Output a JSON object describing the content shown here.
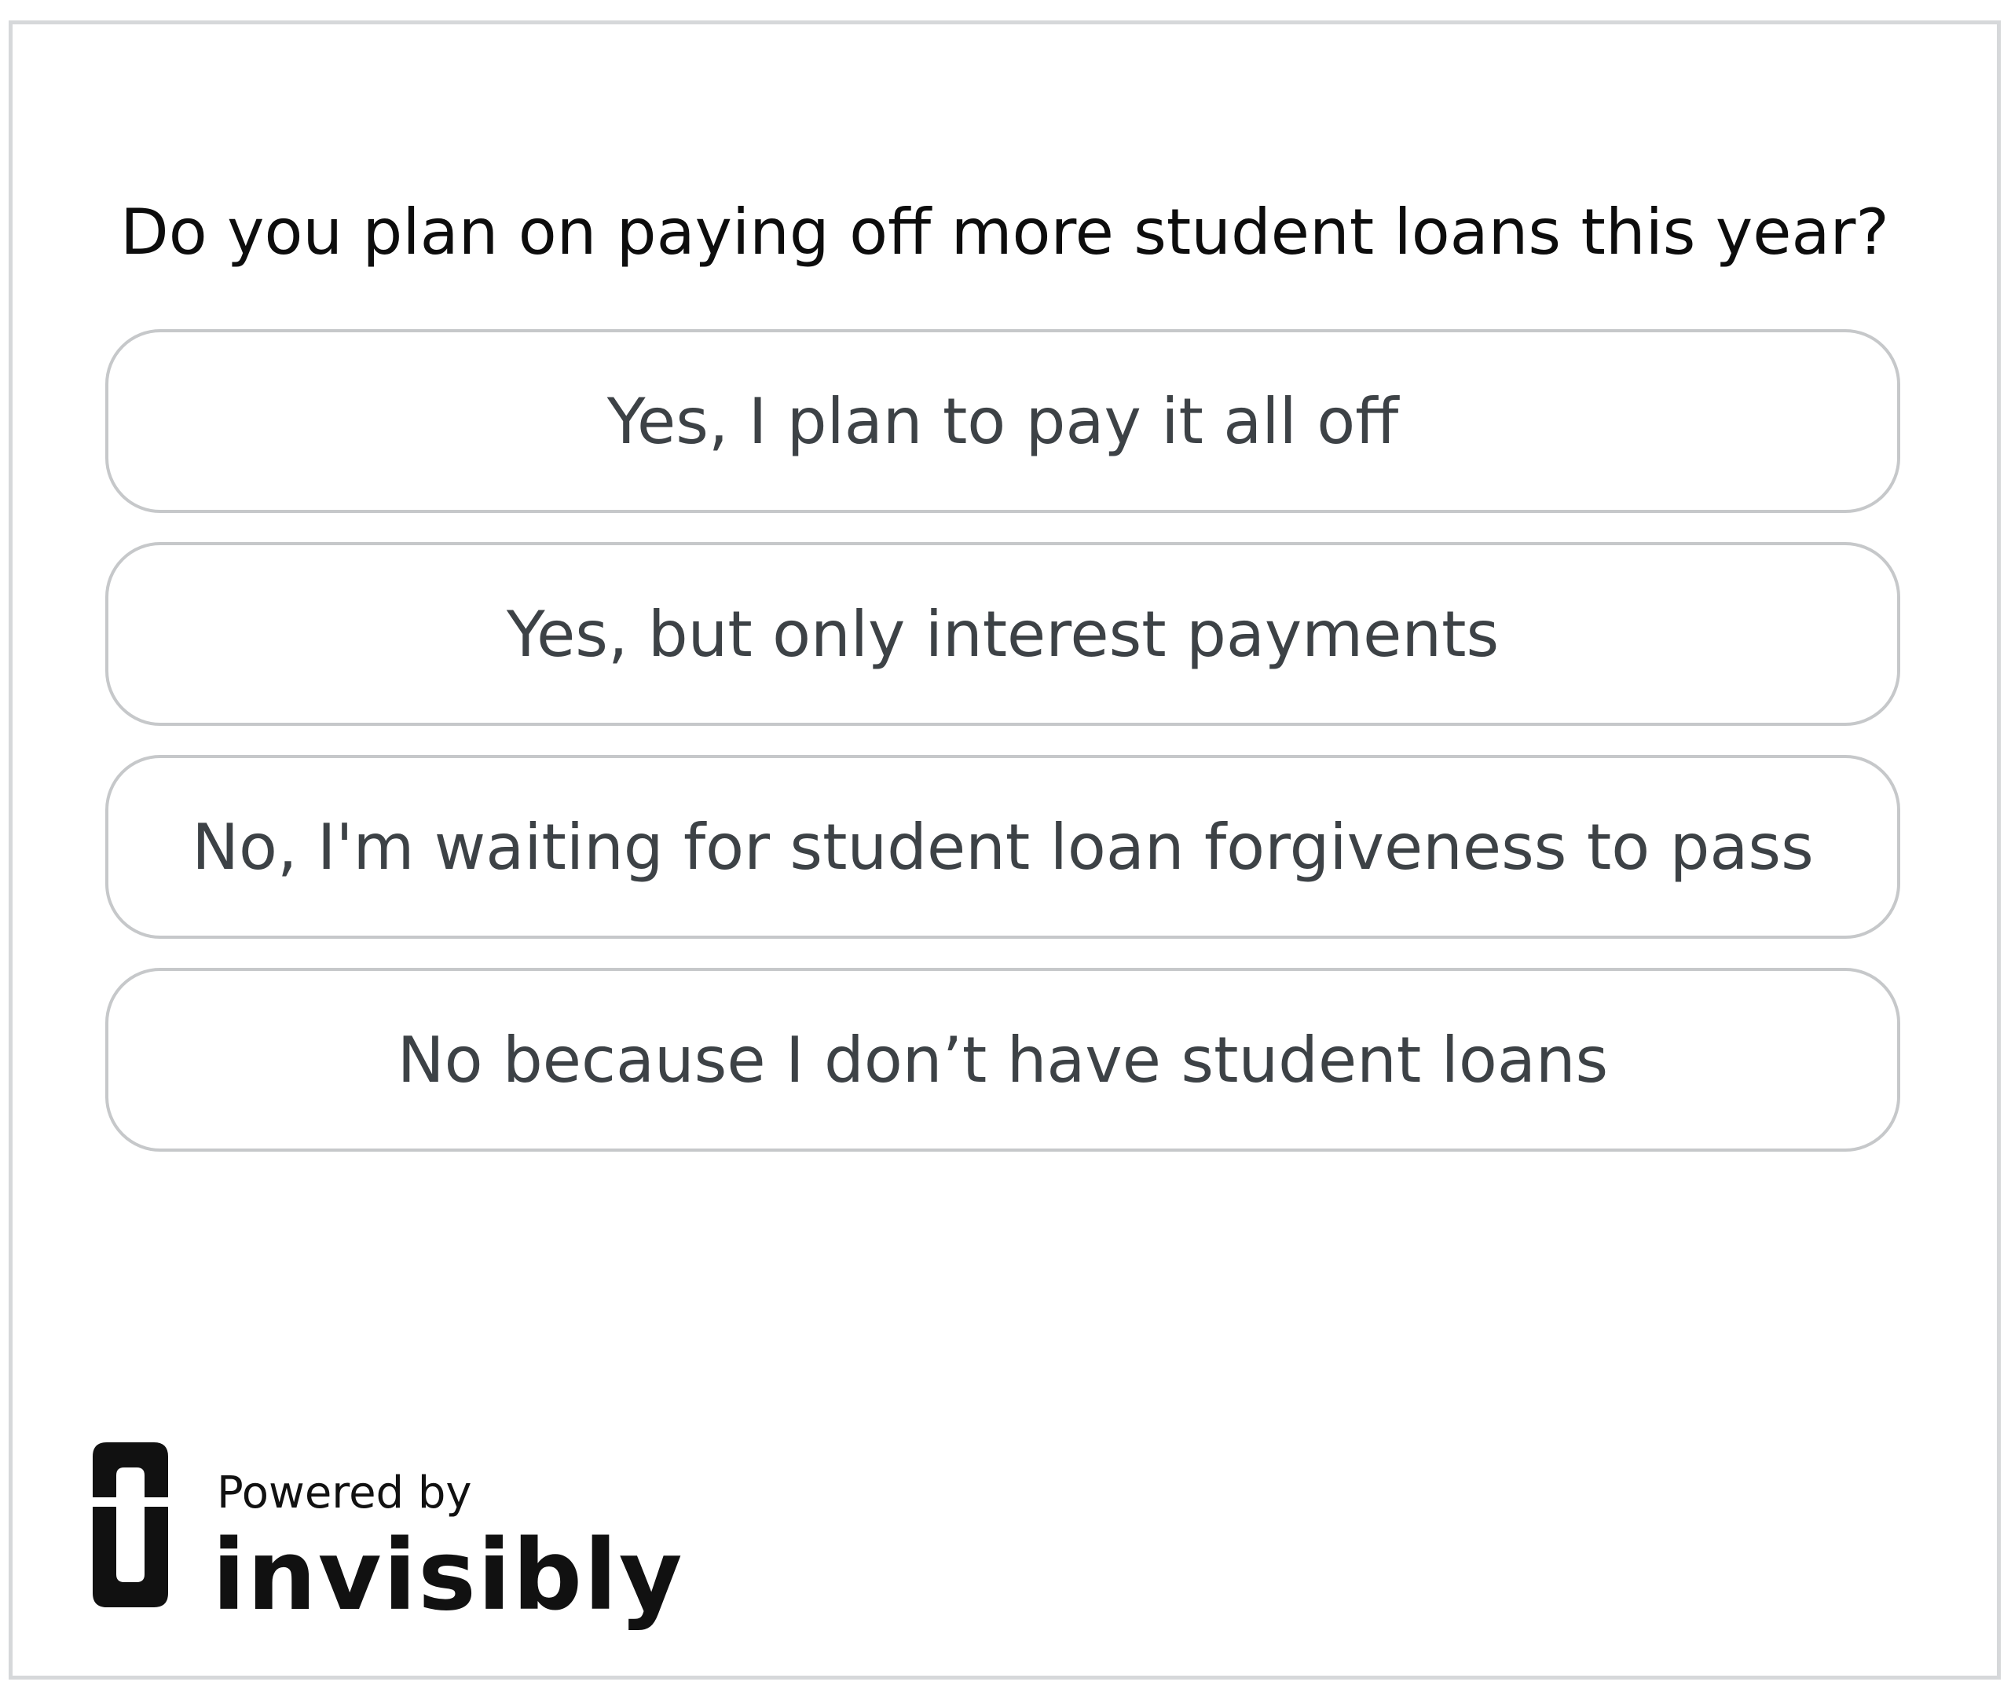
{
  "survey": {
    "question": "Do you plan on paying off more student loans this year?",
    "options": [
      {
        "label": "Yes, I plan to pay it all off"
      },
      {
        "label": "Yes, but only interest payments"
      },
      {
        "label": "No, I'm waiting for student loan forgiveness to pass"
      },
      {
        "label": "No because I don’t have student loans"
      }
    ]
  },
  "footer": {
    "powered_by": "Powered by",
    "brand": "invisibly",
    "logo_icon": "invisibly-logo-icon"
  },
  "colors": {
    "border": "#d6d8da",
    "option_border": "#c6c8ca",
    "question_text": "#0d0d0d",
    "option_text": "#3d4246",
    "brand": "#111111"
  }
}
